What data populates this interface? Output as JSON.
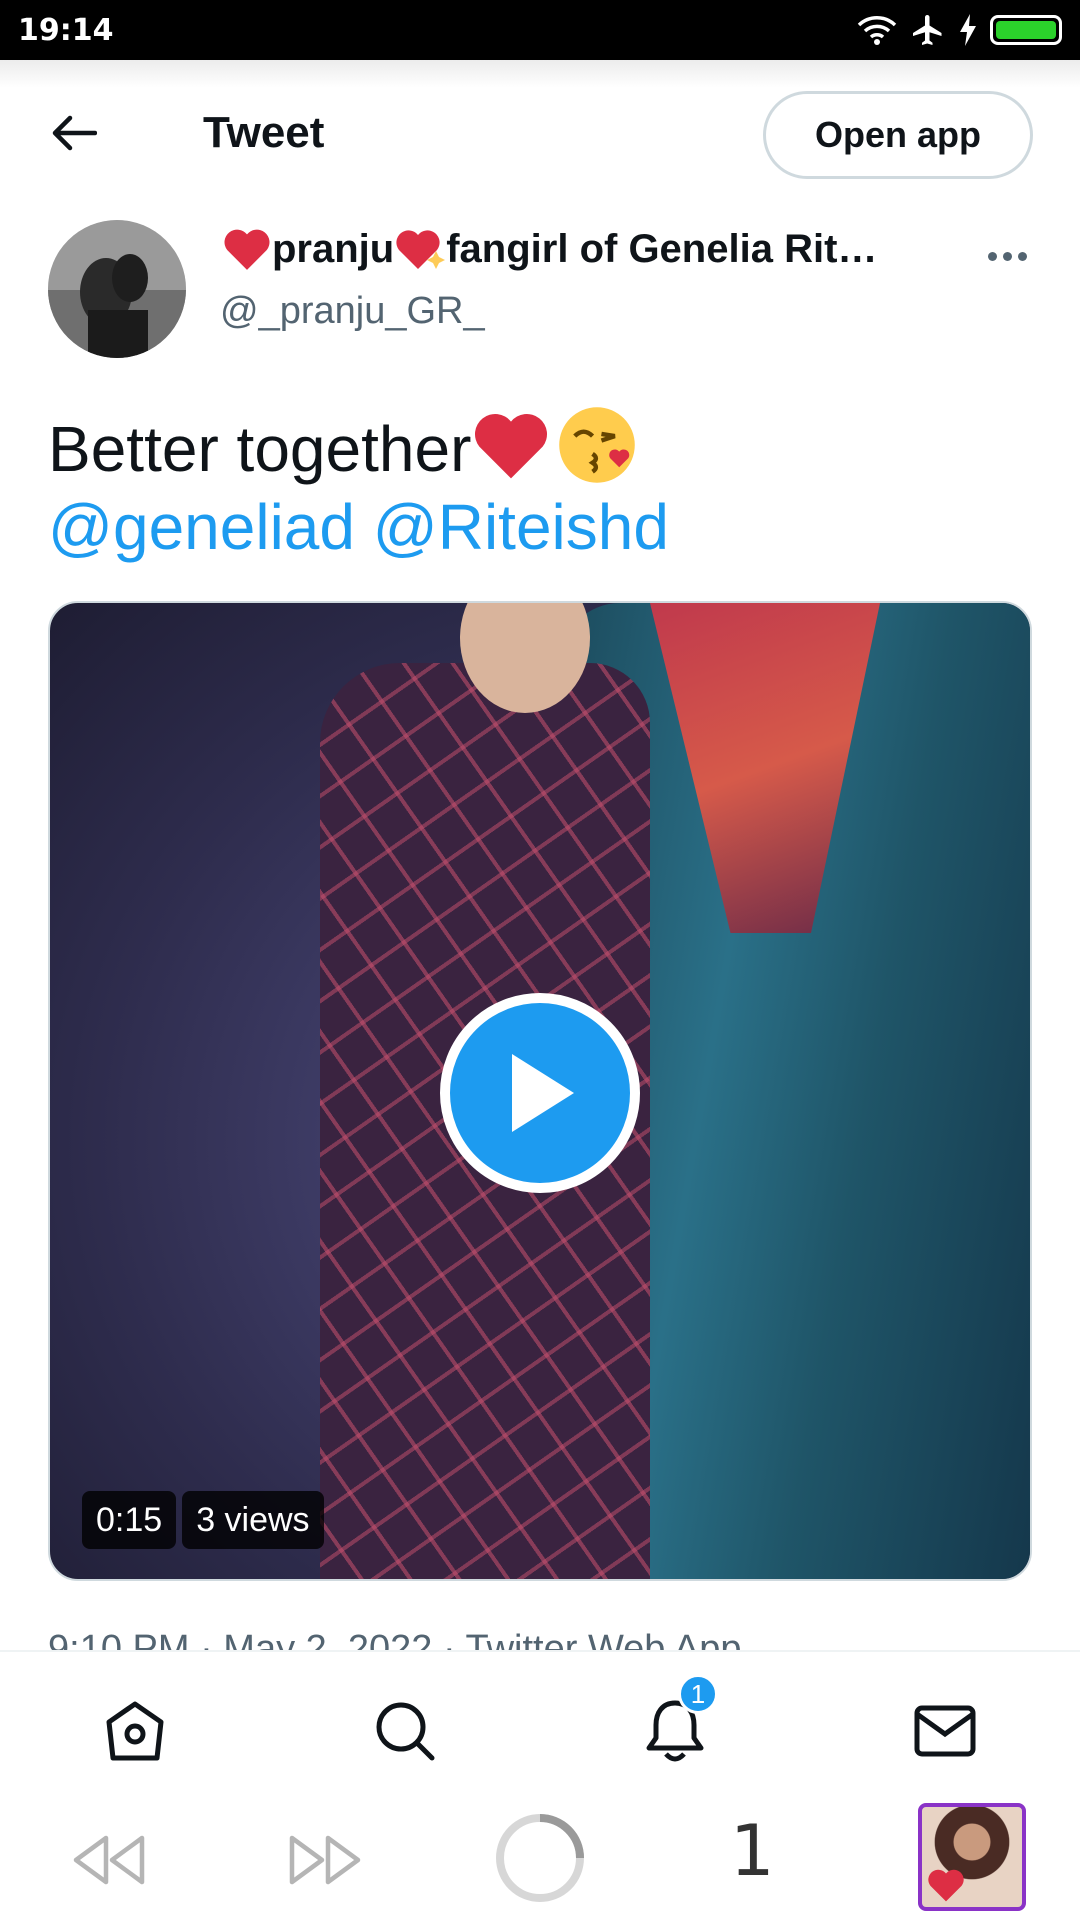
{
  "status_bar": {
    "time": "19:14",
    "battery_color": "#2bd12b"
  },
  "header": {
    "title": "Tweet",
    "open_app_label": "Open app"
  },
  "author": {
    "display_name_a": "pranju",
    "display_name_b": "fangirl of Genelia Rit…",
    "handle": "@_pranju_GR_"
  },
  "tweet": {
    "text": "Better together",
    "mentions": [
      "@geneliad",
      "@Riteishd"
    ]
  },
  "media": {
    "duration": "0:15",
    "views": "3 views"
  },
  "meta": {
    "line": "9:10 PM · May 2, 2022 · Twitter Web App"
  },
  "bottom_nav": {
    "notification_count": "1"
  },
  "browser_bar": {
    "tab_count": "1"
  },
  "colors": {
    "accent": "#1d9bf0",
    "text": "#0f1419",
    "secondary_text": "#536471",
    "heart": "#e0245e"
  }
}
